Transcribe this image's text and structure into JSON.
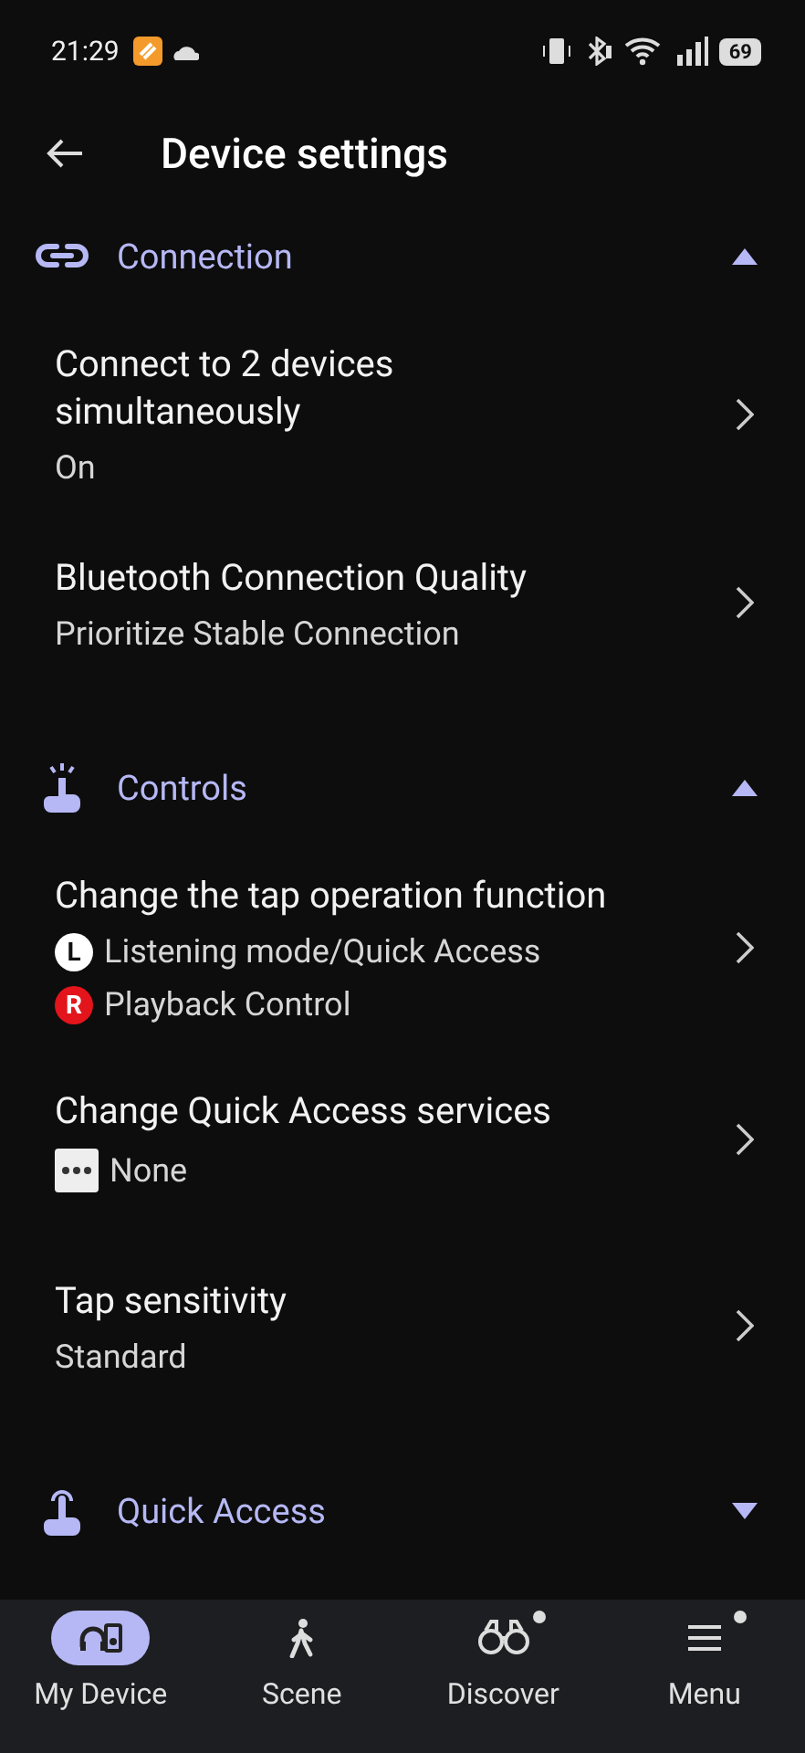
{
  "status_bar": {
    "time": "21:29",
    "battery": "69"
  },
  "header": {
    "title": "Device settings"
  },
  "sections": [
    {
      "title": "Connection",
      "expanded": true,
      "items": [
        {
          "title": "Connect to 2 devices simultaneously",
          "lines": [
            {
              "kind": "plain",
              "text": "On"
            }
          ]
        },
        {
          "title": "Bluetooth Connection Quality",
          "lines": [
            {
              "kind": "plain",
              "text": "Prioritize Stable Connection"
            }
          ]
        }
      ]
    },
    {
      "title": "Controls",
      "expanded": true,
      "items": [
        {
          "title": "Change the tap operation function",
          "lines": [
            {
              "kind": "badge",
              "badge": "L",
              "color": "#ffffff",
              "text": "Listening mode/Quick Access"
            },
            {
              "kind": "badge",
              "badge": "R",
              "color": "#e3141b",
              "text": "Playback Control"
            }
          ]
        },
        {
          "title": "Change Quick Access services",
          "lines": [
            {
              "kind": "more",
              "text": "None"
            }
          ]
        },
        {
          "title": "Tap sensitivity",
          "lines": [
            {
              "kind": "plain",
              "text": "Standard"
            }
          ]
        }
      ]
    },
    {
      "title": "Quick Access",
      "expanded": false
    }
  ],
  "nav": [
    {
      "label": "My Device",
      "selected": true,
      "dot": false
    },
    {
      "label": "Scene",
      "selected": false,
      "dot": false
    },
    {
      "label": "Discover",
      "selected": false,
      "dot": true
    },
    {
      "label": "Menu",
      "selected": false,
      "dot": true
    }
  ]
}
